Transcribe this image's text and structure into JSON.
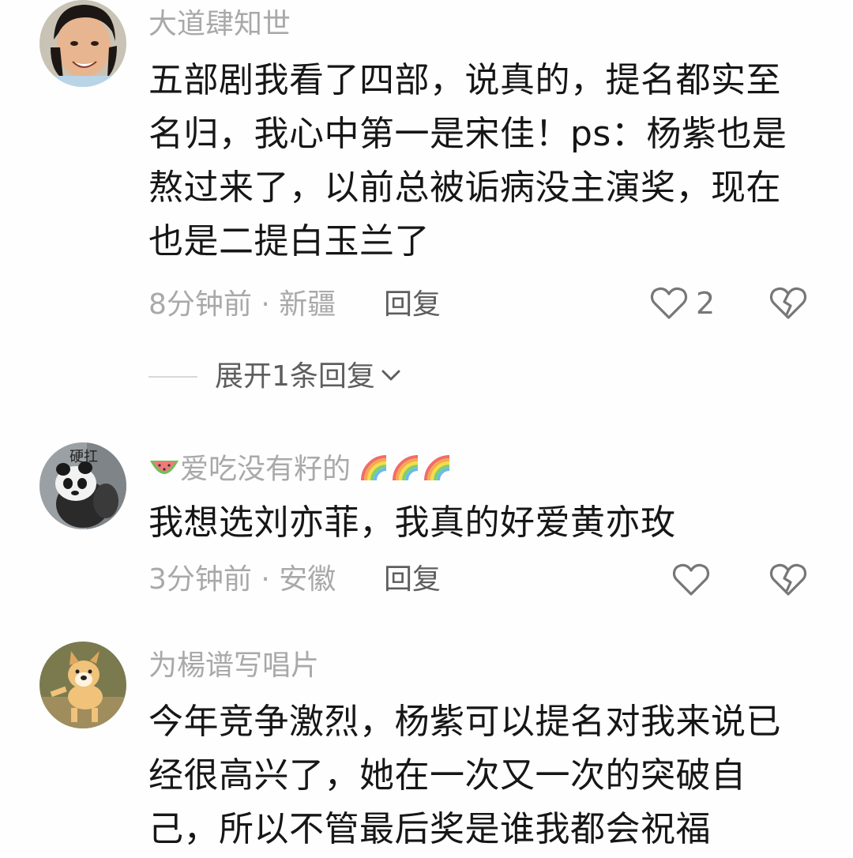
{
  "comments": [
    {
      "username": "大道肆知世",
      "lines": [
        "五部剧我看了四部，说真的，提名都实至",
        "名归，我心中第一是宋佳！ps：杨紫也是",
        "熬过来了，以前总被诟病没主演奖，现在",
        "也是二提白玉兰了"
      ],
      "time_location": "8分钟前 · 新疆",
      "reply_label": "回复",
      "like_count": "2",
      "expand_label": "展开1条回复"
    },
    {
      "username": "爱吃没有籽的",
      "avatar_caption": "硬扛",
      "lines": [
        "我想选刘亦菲，我真的好爱黄亦玫"
      ],
      "time_location": "3分钟前 · 安徽",
      "reply_label": "回复"
    },
    {
      "username": "为楊谱写唱片",
      "lines": [
        "今年竞争激烈，杨紫可以提名对我来说已",
        "经很高兴了，她在一次又一次的突破自",
        "己，所以不管最后奖是谁我都会祝福"
      ]
    }
  ],
  "icons": {
    "like": "heart-outline-icon",
    "dislike": "broken-heart-icon",
    "expand": "chevron-down-icon",
    "username_prefix": "watermelon-emoji",
    "username_suffix": "rainbow-emoji"
  },
  "colors": {
    "primary_text": "#161616",
    "secondary_text": "#a9a9a9",
    "action_text": "#5e5e5e",
    "icon": "#777777"
  }
}
